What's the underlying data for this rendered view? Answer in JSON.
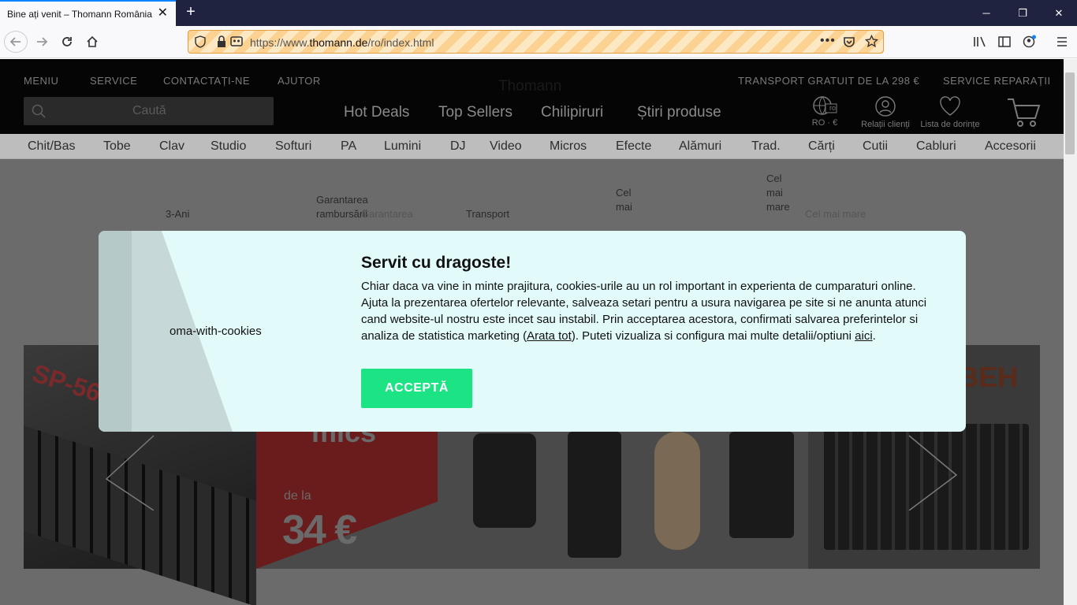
{
  "browser": {
    "tab_title": "Bine ați venit – Thomann România",
    "url_prefix": "https://www.",
    "url_domain": "thomann.de",
    "url_path": "/ro/index.html"
  },
  "site": {
    "top_links": [
      "MENIU",
      "SERVICE",
      "CONTACTAȚI-NE",
      "AJUTOR"
    ],
    "logo": "Thomann",
    "shipping_note": "TRANSPORT GRATUIT DE LA 298 €",
    "repair_link": "SERVICE REPARAȚII",
    "search_placeholder": "Caută",
    "main_links": [
      "Hot Deals",
      "Top Sellers",
      "Chilipiruri",
      "Știri produse"
    ],
    "header_icons": {
      "locale_badge": "ro",
      "locale": "RO · €",
      "customer": "Relații clienți",
      "wishlist": "Lista de dorințe"
    },
    "categories": [
      "Chit/Bas",
      "Tobe",
      "Clav",
      "Studio",
      "Softuri",
      "PA",
      "Lumini",
      "DJ",
      "Video",
      "Micros",
      "Efecte",
      "Alămuri",
      "Trad.",
      "Cărți",
      "Cutii",
      "Cabluri",
      "Accesorii"
    ],
    "features": {
      "f1": "3-Ani",
      "f2": "Garantarea rambursării",
      "f2b": "Garantarea",
      "f3": "Transport",
      "f4": "Cel mai",
      "f5": "Cel mai mare",
      "f6": "Cel mai mare"
    },
    "banner": {
      "price_from": "de la",
      "price": "34 €",
      "word": "mics"
    }
  },
  "cookie_modal": {
    "image_alt": "oma-with-cookies",
    "title": "Servit cu dragoste!",
    "body_1": "Chiar daca va vine in minte prajitura, cookies-urile au un rol important in experienta de cumparaturi online. Ajuta la prezentarea ofertelor relevante, salveaza setari pentru a usura navigarea pe site si ne anunta atunci cand website-ul nostru este incet sau instabil. Prin acceptarea acestora, confirmati salvarea preferintelor si analiza de statistica marketing (",
    "link_show_all": "Arata tot",
    "body_2": "). Puteti vizualiza si configura mai multe detalii/optiuni ",
    "link_here": "aici",
    "body_3": ".",
    "accept_label": "ACCEPTĂ"
  }
}
